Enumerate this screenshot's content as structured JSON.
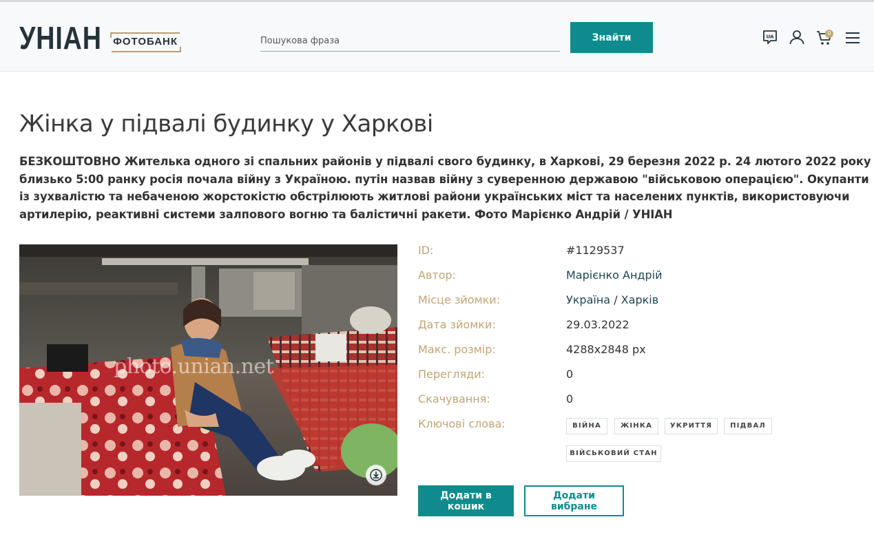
{
  "header": {
    "logo_main": "УНІАН",
    "logo_sub": "ФОТОБАНК",
    "search_placeholder": "Пошукова фраза",
    "search_button": "Знайти",
    "language_label": "UA",
    "cart_count": "0",
    "icons": [
      "language-icon",
      "user-icon",
      "cart-icon",
      "menu-icon"
    ]
  },
  "photo": {
    "title": "Жінка у підвалі будинку у Харкові",
    "description": "БЕЗКОШТОВНО Жителька одного зі спальних районів у підвалі свого будинку, в Харкові, 29 березня 2022 р. 24 лютого 2022 року близько 5:00 ранку росія почала війну з Україною. путін назвав війну з суверенною державою \"військовою операцією\". Окупанти із зухвалістю та небаченою жорстокістю обстрілюють житлові райони українських міст та населених пунктів, використовуючи артилерію, реактивні системи залпового вогню та балістичні ракети. Фото Марієнко Андрій / УНІАН",
    "watermark": "photo.unian.net"
  },
  "meta": {
    "id_label": "ID:",
    "id_value": "#1129537",
    "author_label": "Автор:",
    "author_value": "Марієнко Андрій",
    "place_label": "Місце зйомки:",
    "place_country": "Україна",
    "place_separator": "/",
    "place_city": "Харків",
    "date_label": "Дата зйомки:",
    "date_value": "29.03.2022",
    "size_label": "Макс. розмір:",
    "size_value": "4288x2848 px",
    "views_label": "Перегляди:",
    "views_value": "0",
    "downloads_label": "Скачування:",
    "downloads_value": "0",
    "keywords_label": "Ключові слова:",
    "keywords": [
      "ВІЙНА",
      "ЖІНКА",
      "УКРИТТЯ",
      "ПІДВАЛ",
      "ВІЙСЬКОВИЙ СТАН"
    ]
  },
  "actions": {
    "add_to_cart": "Додати в кошик",
    "add_to_favorites": "Додати вибране"
  },
  "colors": {
    "accent": "#0f8b8d",
    "label": "#c2a476",
    "logo": "#24333c",
    "header_bg": "#f8f9fa"
  }
}
